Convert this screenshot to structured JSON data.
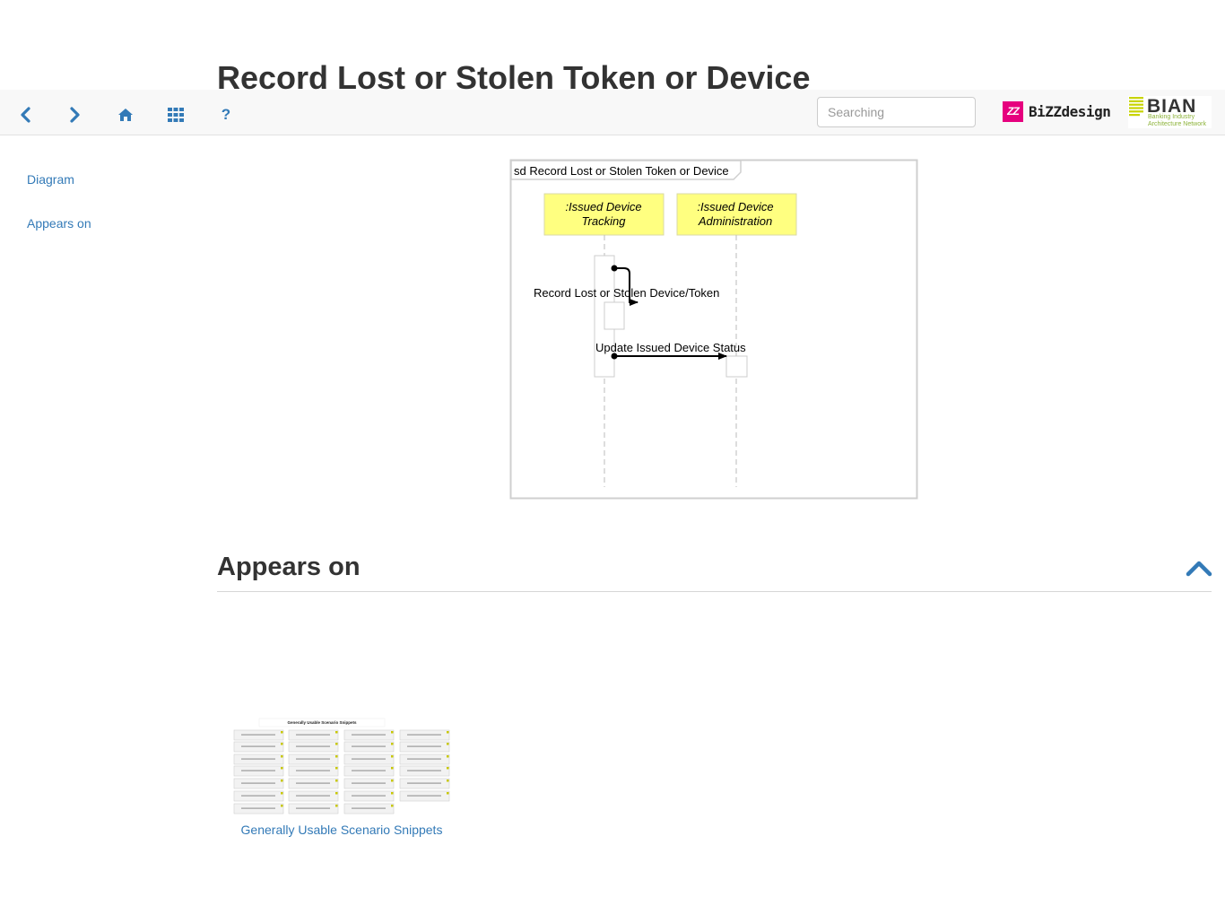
{
  "page": {
    "title": "Record Lost or Stolen Token or Device"
  },
  "toolbar": {
    "back_icon": "chevron-left-icon",
    "forward_icon": "chevron-right-icon",
    "home_icon": "home-icon",
    "grid_icon": "grid-icon",
    "help_label": "?",
    "search_placeholder": "Searching",
    "bizzdesign_mark": "ZZ",
    "bizzdesign_name": "BiZZdesign",
    "bian_name": "BIAN",
    "bian_tagline_1": "Banking Industry",
    "bian_tagline_2": "Architecture Network",
    "accent_color": "#337ab7"
  },
  "sidenav": {
    "items": [
      {
        "label": "Diagram"
      },
      {
        "label": "Appears on"
      }
    ]
  },
  "diagram": {
    "frame_label": "sd Record Lost or Stolen Token or Device",
    "lifelines": [
      {
        "line1": ":Issued Device",
        "line2": "Tracking"
      },
      {
        "line1": ":Issued Device",
        "line2": "Administration"
      }
    ],
    "messages": [
      {
        "label": "Record Lost or Stolen Device/Token",
        "kind": "self"
      },
      {
        "label": "Update Issued Device Status",
        "kind": "call"
      }
    ],
    "lifeline_fill": "#ffff80"
  },
  "appears_on": {
    "heading": "Appears on",
    "items": [
      {
        "caption": "Generally Usable Scenario Snippets",
        "thumbnail_title": "Generally Usable Scenario Snippets"
      }
    ]
  }
}
